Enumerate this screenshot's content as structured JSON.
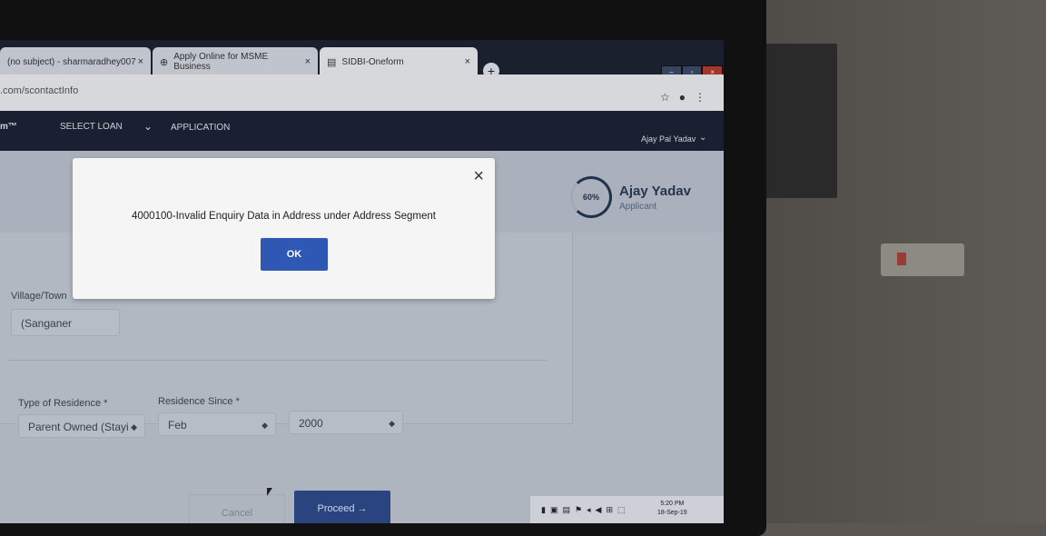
{
  "browser": {
    "tabs": [
      {
        "title": "(no subject) - sharmaradhey007",
        "close": "×"
      },
      {
        "icon": "globe-icon",
        "title": "Apply Online for MSME Business",
        "close": "×"
      },
      {
        "icon": "doc-icon",
        "title": "SIDBI-Oneform",
        "close": "×"
      }
    ],
    "new_tab": "+",
    "url": ".com/scontactInfo",
    "window_controls": [
      "–",
      "▫",
      "×"
    ]
  },
  "nav": {
    "brand": "m™",
    "menu": [
      "SELECT LOAN",
      "APPLICATION"
    ],
    "user": "Ajay Pal Yadav"
  },
  "profile": {
    "progress": "60%",
    "name": "Ajay Yadav",
    "role": "Applicant"
  },
  "form": {
    "village_label": "Village/Town",
    "village_value": "(Sanganer",
    "residence_type_label": "Type of Residence *",
    "residence_type_value": "Parent Owned (Stayi",
    "residence_since_label": "Residence Since *",
    "residence_month": "Feb",
    "residence_year": "2000"
  },
  "actions": {
    "cancel": "Cancel",
    "proceed": "Proceed →"
  },
  "modal": {
    "message": "4000100-Invalid Enquiry Data in Address under Address Segment",
    "ok": "OK",
    "close": "×"
  },
  "taskbar": {
    "time": "5:20 PM",
    "date": "18-Sep-19"
  }
}
